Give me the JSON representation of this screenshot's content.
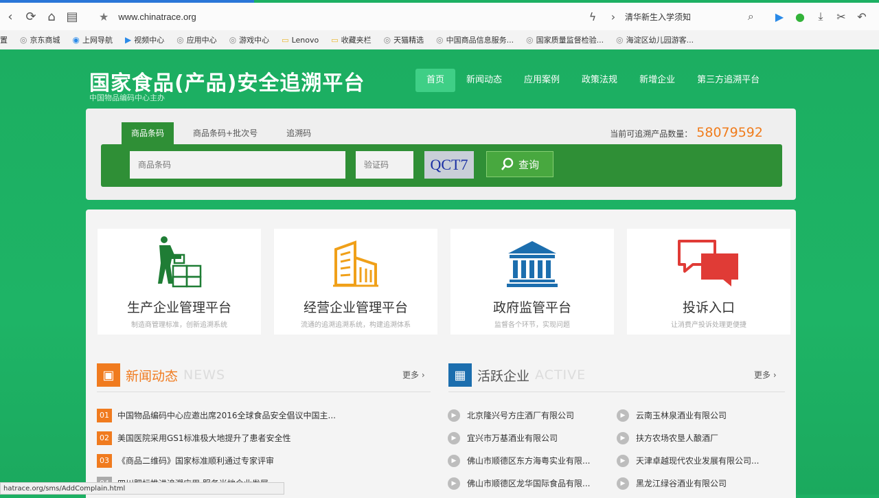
{
  "browser": {
    "url": "www.chinatrace.org",
    "search_value": "清华新生入学须知",
    "bookmarks": [
      "置",
      "京东商城",
      "上网导航",
      "视频中心",
      "应用中心",
      "游戏中心",
      "Lenovo",
      "收藏夹栏",
      "天猫精选",
      "中国商品信息服务...",
      "国家质量监督检验...",
      "海淀区幼儿园游客..."
    ],
    "status_url": "hatrace.org/sms/AddComplain.html"
  },
  "header": {
    "title": "国家食品(产品)安全追溯平台",
    "subtitle": "中国物品编码中心主办",
    "nav": [
      "首页",
      "新闻动态",
      "应用案例",
      "政策法规",
      "新增企业",
      "第三方追溯平台"
    ]
  },
  "search": {
    "tabs": [
      "商品条码",
      "商品条码+批次号",
      "追溯码"
    ],
    "count_label": "当前可追溯产品数量：",
    "count_value": "58079592",
    "barcode_placeholder": "商品条码",
    "captcha_placeholder": "验证码",
    "captcha_text": "QCT7",
    "button_label": "查询"
  },
  "cards": [
    {
      "title": "生产企业管理平台",
      "sub": "制造商管理标准，创新追溯系统"
    },
    {
      "title": "经营企业管理平台",
      "sub": "流通的追溯追溯系统，构建追溯体系"
    },
    {
      "title": "政府监管平台",
      "sub": "监督各个环节，实现问题"
    },
    {
      "title": "投诉入口",
      "sub": "让消费产投诉处理更便捷"
    }
  ],
  "news": {
    "title": "新闻动态",
    "title_en": "NEWS",
    "more": "更多 ›",
    "items": [
      {
        "num": "01",
        "text": "中国物品编码中心应邀出席2016全球食品安全倡议中国主..."
      },
      {
        "num": "02",
        "text": "美国医院采用GS1标准极大地提升了患者安全性"
      },
      {
        "num": "03",
        "text": "《商品二维码》国家标准顺利通过专家评审"
      },
      {
        "num": "04",
        "text": "四川肥标推进追溯应用 服务当地企业发展"
      }
    ]
  },
  "active": {
    "title": "活跃企业",
    "title_en": "ACTIVE",
    "more": "更多 ›",
    "items": [
      "北京隆兴号方庄酒厂有限公司",
      "云南玉林泉酒业有限公司",
      "宜兴市万基酒业有限公司",
      "扶方农场农垦人酿酒厂",
      "佛山市顺德区东方海粤实业有限...",
      "天津卓越现代农业发展有限公司...",
      "佛山市顺德区龙华国际食品有限...",
      "黑龙江绿谷酒业有限公司"
    ]
  }
}
